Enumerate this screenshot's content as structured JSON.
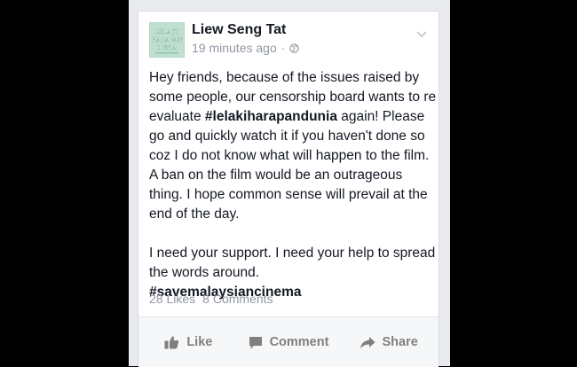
{
  "post": {
    "author": "Liew Seng Tat",
    "time": "19 minutes ago",
    "separator": "·",
    "avatar_text": [
      "LELAKI",
      "HARAPAN",
      "DUNIA"
    ],
    "paragraph1_a": "Hey friends, because of the issues raised by some people, our censorship board wants to re evaluate ",
    "hashtag1": "#lelakiharapandunia",
    "paragraph1_b": " again! Please go and quickly watch it if you haven't done so coz I do not know what will happen to the film. A ban on the film would be an outrageous thing. I hope common sense will prevail at the end of the day.",
    "paragraph2": "I need your support. I need your help to spread the words around.",
    "hashtag2": "#savemalaysiancinema",
    "likes": "28 Likes",
    "comments": "8 Comments"
  },
  "actions": {
    "like": "Like",
    "comment": "Comment",
    "share": "Share"
  },
  "icons": {
    "globe": "globe-icon",
    "chevron": "chevron-down-icon",
    "like": "thumbs-up-icon",
    "comment": "speech-bubble-icon",
    "share": "share-arrow-icon"
  },
  "colors": {
    "text": "#141823",
    "meta": "#9197a3",
    "action": "#7f7f7f",
    "avatar_bg": "#bfe0d0"
  }
}
